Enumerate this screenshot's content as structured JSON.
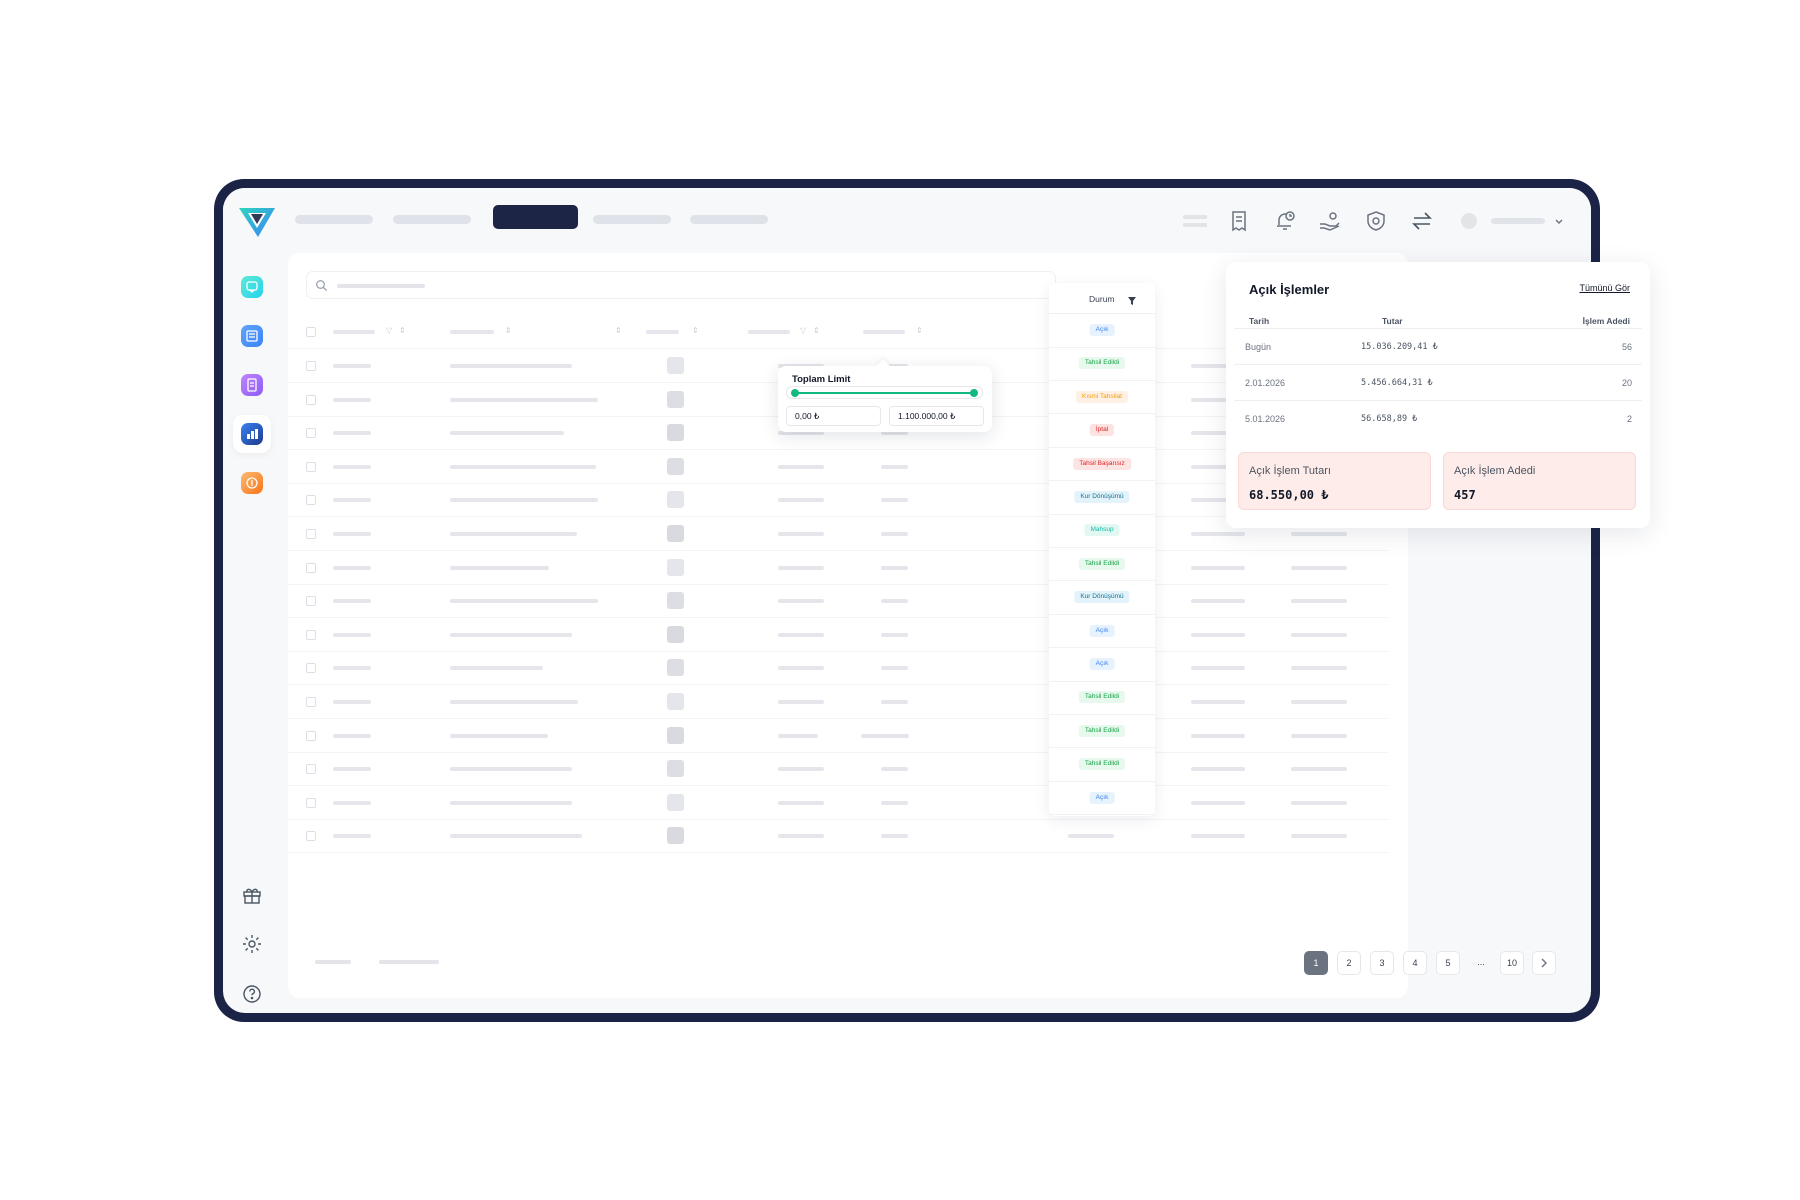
{
  "status_column": {
    "header": "Durum",
    "rows": [
      {
        "label": "Açık",
        "bg": "#e6f2fd",
        "fg": "#3b82f6"
      },
      {
        "label": "Tahsil Edildi",
        "bg": "#e7f8ec",
        "fg": "#16a34a"
      },
      {
        "label": "Kısmi Tahsilat",
        "bg": "#fef0e2",
        "fg": "#f59e0b"
      },
      {
        "label": "İptal",
        "bg": "#fde2e2",
        "fg": "#dc2626"
      },
      {
        "label": "Tahsil Başarısız",
        "bg": "#fde4e4",
        "fg": "#dc2626"
      },
      {
        "label": "Kur Dönüşümü",
        "bg": "#e3f3fb",
        "fg": "#0e7490"
      },
      {
        "label": "Mahsup",
        "bg": "#e3f8f3",
        "fg": "#14b8a6"
      },
      {
        "label": "Tahsil Edildi",
        "bg": "#e7f8ec",
        "fg": "#16a34a"
      },
      {
        "label": "Kur Dönüşümü",
        "bg": "#e3f3fb",
        "fg": "#0e7490"
      },
      {
        "label": "Açık",
        "bg": "#e6f2fd",
        "fg": "#3b82f6"
      },
      {
        "label": "Açık",
        "bg": "#e6f2fd",
        "fg": "#3b82f6"
      },
      {
        "label": "Tahsil Edildi",
        "bg": "#e7f8ec",
        "fg": "#16a34a"
      },
      {
        "label": "Tahsil Edildi",
        "bg": "#e7f8ec",
        "fg": "#16a34a"
      },
      {
        "label": "Tahsil Edildi",
        "bg": "#e7f8ec",
        "fg": "#16a34a"
      },
      {
        "label": "Açık",
        "bg": "#e6f2fd",
        "fg": "#3b82f6"
      }
    ]
  },
  "limit_filter": {
    "title": "Toplam Limit",
    "min_value": "0,00 ₺",
    "max_value": "1.100.000,00 ₺"
  },
  "open_transactions": {
    "title": "Açık İşlemler",
    "see_all": "Tümünü Gör",
    "headers": {
      "date": "Tarih",
      "amount": "Tutar",
      "count": "İşlem Adedi"
    },
    "rows": [
      {
        "date": "Bugün",
        "amount": "15.036.209,41 ₺",
        "count": "56"
      },
      {
        "date": "2.01.2026",
        "amount": "5.456.664,31 ₺",
        "count": "20"
      },
      {
        "date": "5.01.2026",
        "amount": "56.658,89 ₺",
        "count": "2"
      }
    ],
    "total_amount_label": "Açık İşlem Tutarı",
    "total_amount_value": "68.550,00 ₺",
    "total_count_label": "Açık İşlem Adedi",
    "total_count_value": "457"
  },
  "pagination": {
    "pages": [
      "1",
      "2",
      "3",
      "4",
      "5",
      "...",
      "10"
    ],
    "current": "1"
  },
  "colors": {
    "frame": "#1b2447",
    "active_nav": "#1c2546",
    "accent_green": "#10b981"
  },
  "icons": {
    "sidebar": [
      "chat-icon",
      "list-icon",
      "document-icon",
      "dashboard-icon",
      "coin-icon"
    ],
    "sidebar_bottom": [
      "gift-icon",
      "gear-icon",
      "help-icon"
    ],
    "topbar": [
      "menu-icon",
      "receipt-icon",
      "notification-clock-icon",
      "hand-money-icon",
      "shield-icon",
      "transfer-icon"
    ]
  }
}
